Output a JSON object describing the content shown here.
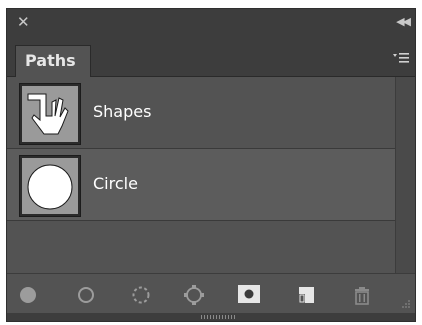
{
  "panel": {
    "tab_label": "Paths",
    "titlebar": {
      "close_glyph": "✕",
      "collapse_glyph": "◀◀"
    }
  },
  "paths": [
    {
      "name": "Shapes",
      "thumbnail": "hand-shape-thumbnail",
      "selected": false
    },
    {
      "name": "Circle",
      "thumbnail": "circle-shape-thumbnail",
      "selected": true
    }
  ],
  "toolbar_icons": [
    "fill-path-icon",
    "stroke-path-icon",
    "load-as-selection-icon",
    "make-work-path-icon",
    "add-mask-icon",
    "new-path-icon",
    "delete-path-icon"
  ],
  "colors": {
    "panel_bg": "#535353",
    "header_bg": "#3d3d3d",
    "text": "#ffffff",
    "icon": "#aeaeae"
  }
}
